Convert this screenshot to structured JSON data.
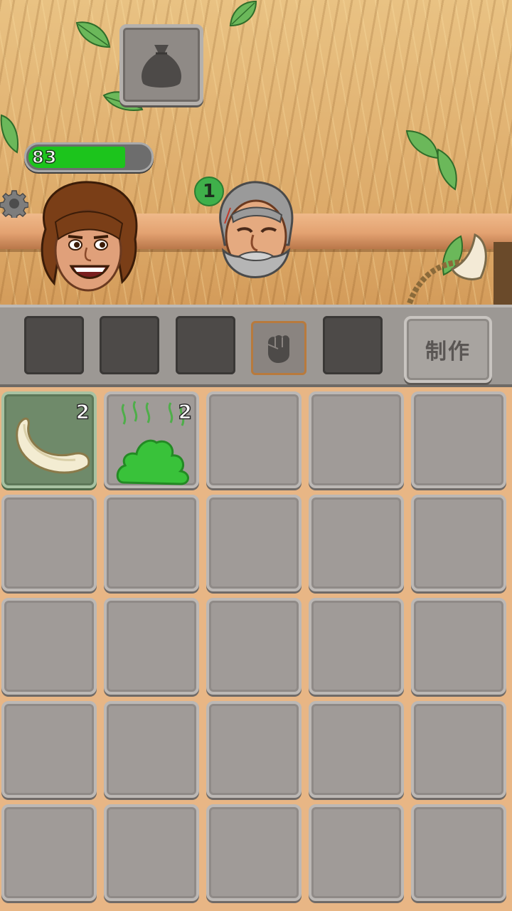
{
  "player": {
    "health": 83,
    "health_fraction": 0.83,
    "avatar": "caveman-young-icon"
  },
  "npc": {
    "avatar": "caveman-elder-icon",
    "badge_count": "1"
  },
  "bag": {
    "icon": "bag-icon"
  },
  "settings": {
    "icon": "gear-icon"
  },
  "crafting": {
    "slot_count": 5,
    "fist_icon": "fist-icon",
    "button_label": "制作"
  },
  "inventory": {
    "items": [
      {
        "name": "banana",
        "icon": "banana-icon",
        "count": "2"
      },
      {
        "name": "poop",
        "icon": "poop-icon",
        "count": "2"
      }
    ]
  },
  "colors": {
    "health_fill": "#1cc41c",
    "stone": "#a09b98",
    "selected_cell": "#6f8a6a"
  }
}
